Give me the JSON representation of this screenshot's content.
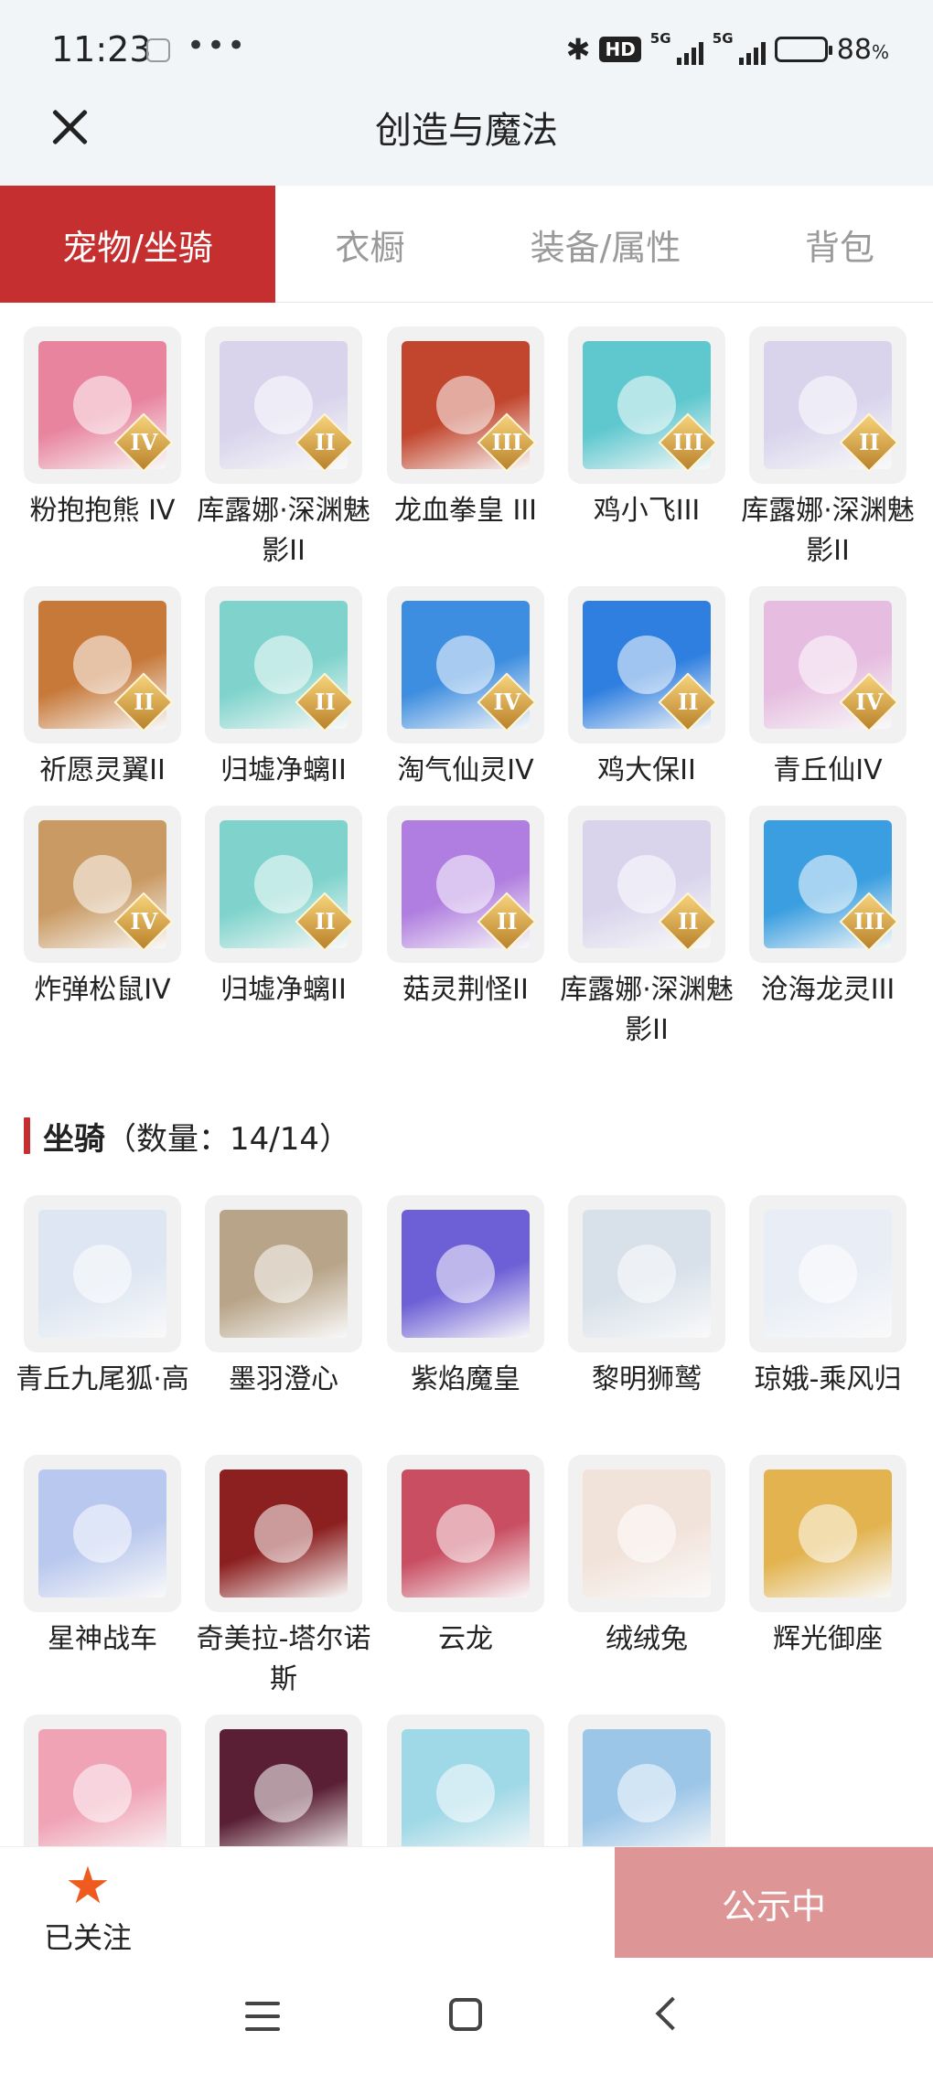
{
  "status_bar": {
    "time": "11:23",
    "dots": "•••",
    "hd_label": "HD",
    "signal_1": "5G",
    "signal_2": "5G",
    "battery": "88",
    "battery_unit": "%"
  },
  "header": {
    "title": "创造与魔法"
  },
  "tabs": [
    {
      "label": "宠物/坐骑",
      "active": true
    },
    {
      "label": "衣橱",
      "active": false
    },
    {
      "label": "装备/属性",
      "active": false
    },
    {
      "label": "背包",
      "active": false
    }
  ],
  "pets": [
    {
      "name": "粉抱抱熊 IV",
      "tier": "IV",
      "color": "#e8849e"
    },
    {
      "name": "库露娜·深渊魅影II",
      "tier": "II",
      "color": "#d9d4ec"
    },
    {
      "name": "龙血拳皇 III",
      "tier": "III",
      "color": "#c2452d"
    },
    {
      "name": "鸡小飞III",
      "tier": "III",
      "color": "#5fc8cf"
    },
    {
      "name": "库露娜·深渊魅影II",
      "tier": "II",
      "color": "#d9d4ec"
    },
    {
      "name": "祈愿灵翼II",
      "tier": "II",
      "color": "#c7793a"
    },
    {
      "name": "归墟净螭II",
      "tier": "II",
      "color": "#7fd3cc"
    },
    {
      "name": "淘气仙灵IV",
      "tier": "IV",
      "color": "#3d8de0"
    },
    {
      "name": "鸡大保II",
      "tier": "II",
      "color": "#2f7fe0"
    },
    {
      "name": "青丘仙IV",
      "tier": "IV",
      "color": "#e6bde0"
    },
    {
      "name": "炸弹松鼠IV",
      "tier": "IV",
      "color": "#c99a63"
    },
    {
      "name": "归墟净螭II",
      "tier": "II",
      "color": "#7fd3cc"
    },
    {
      "name": "菇灵荆怪II",
      "tier": "II",
      "color": "#b07ee0"
    },
    {
      "name": "库露娜·深渊魅影II",
      "tier": "II",
      "color": "#d9d4ec"
    },
    {
      "name": "沧海龙灵III",
      "tier": "III",
      "color": "#3a9ee0"
    }
  ],
  "mount_section": {
    "title": "坐骑",
    "count": "（数量：14/14）"
  },
  "mounts": [
    {
      "name": "青丘九尾狐·高",
      "color": "#dde6f2"
    },
    {
      "name": "墨羽澄心",
      "color": "#b8a488"
    },
    {
      "name": "紫焰魔皇",
      "color": "#6d5fd6"
    },
    {
      "name": "黎明狮鹫",
      "color": "#d8e1ea"
    },
    {
      "name": "琼娥-乘风归",
      "color": "#e9eef6"
    },
    {
      "name": "星神战车",
      "color": "#b9c8ee"
    },
    {
      "name": "奇美拉-塔尔诺斯",
      "color": "#8c2020"
    },
    {
      "name": "云龙",
      "color": "#c94e62"
    },
    {
      "name": "绒绒兔",
      "color": "#f2e3da"
    },
    {
      "name": "辉光御座",
      "color": "#e2b34e"
    },
    {
      "name": "",
      "color": "#f0a3b5"
    },
    {
      "name": "",
      "color": "#5a1f34"
    },
    {
      "name": "",
      "color": "#9fd8e6"
    },
    {
      "name": "",
      "color": "#9cc6e8"
    }
  ],
  "bottom": {
    "follow_label": "已关注",
    "star": "★",
    "status_label": "公示中"
  },
  "accent": "#c62f2f"
}
